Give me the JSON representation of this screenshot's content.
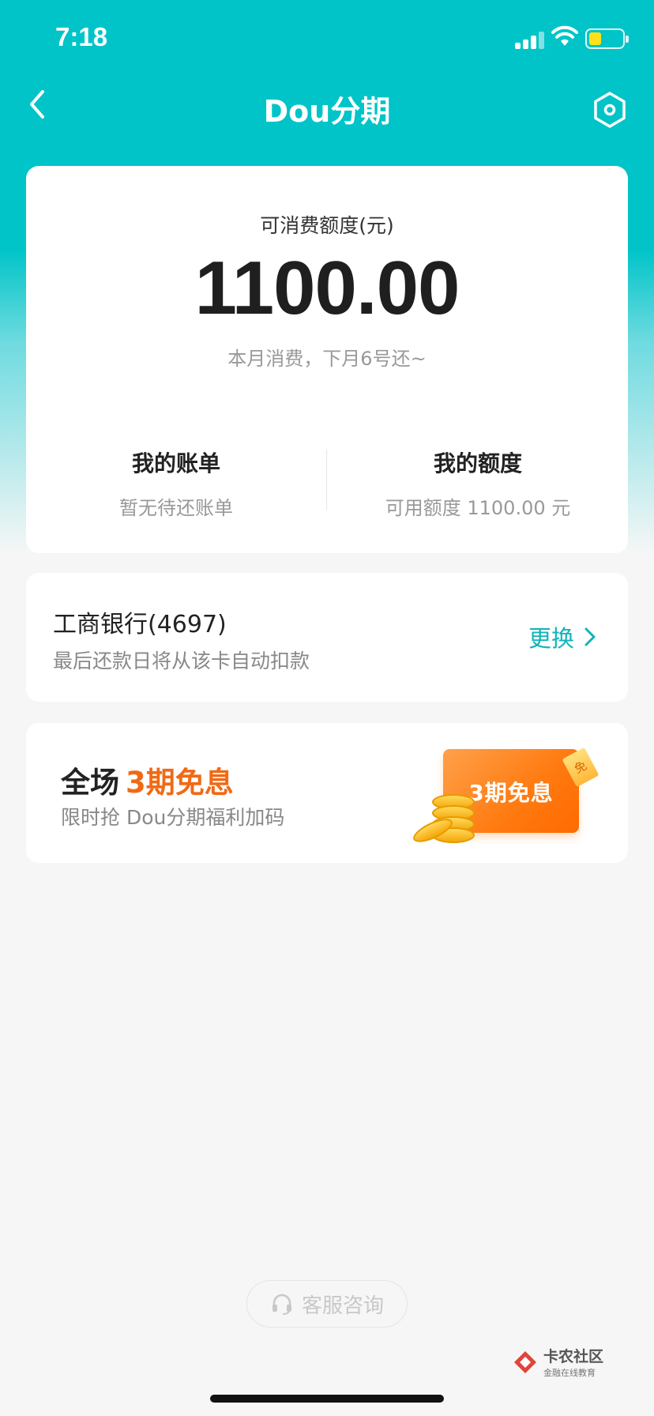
{
  "status_bar": {
    "time": "7:18"
  },
  "nav": {
    "title": "Dou分期"
  },
  "credit": {
    "label": "可消费额度(元)",
    "amount": "1100.00",
    "note": "本月消费，下月6号还~",
    "bill": {
      "title": "我的账单",
      "sub": "暂无待还账单"
    },
    "limit": {
      "title": "我的额度",
      "sub": "可用额度 1100.00 元"
    }
  },
  "bank": {
    "name": "工商银行(4697)",
    "sub": "最后还款日将从该卡自动扣款",
    "change_label": "更换"
  },
  "promo": {
    "title_prefix": "全场",
    "title_highlight": "3期免息",
    "sub": "限时抢 Dou分期福利加码",
    "banner_text": "3期免息",
    "tag": "免"
  },
  "footer": {
    "customer_service": "客服咨询",
    "watermark_title": "卡农社区",
    "watermark_sub": "金融在线教育"
  },
  "colors": {
    "accent": "#00c4c8",
    "promo_orange": "#f06a15",
    "link_teal": "#0fb4b9"
  }
}
